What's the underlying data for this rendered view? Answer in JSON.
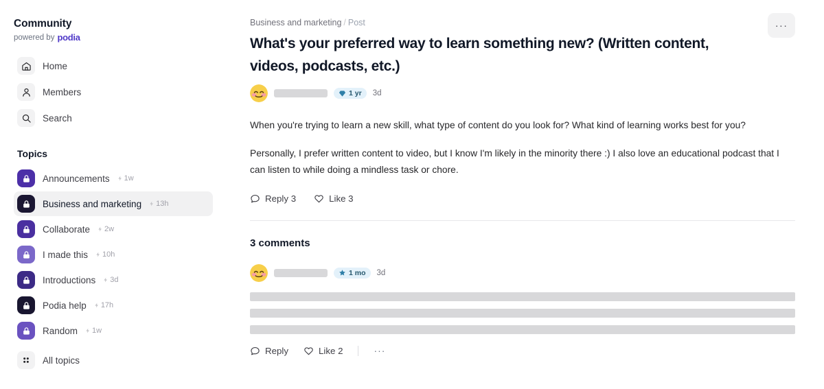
{
  "sidebar": {
    "brand": {
      "title": "Community",
      "powered_prefix": "powered by",
      "powered_brand": "podia",
      "brand_color": "#4f39c8"
    },
    "nav": [
      {
        "label": "Home",
        "icon": "home-icon"
      },
      {
        "label": "Members",
        "icon": "members-icon"
      },
      {
        "label": "Search",
        "icon": "search-icon"
      }
    ],
    "topics_heading": "Topics",
    "topics": [
      {
        "label": "Announcements",
        "time": "1w",
        "icon": "lock-icon",
        "color": "#4c2fa8",
        "active": false
      },
      {
        "label": "Business and marketing",
        "time": "13h",
        "icon": "lock-icon",
        "color": "#1b1733",
        "active": true
      },
      {
        "label": "Collaborate",
        "time": "2w",
        "icon": "lock-icon",
        "color": "#4a2fa0",
        "active": false
      },
      {
        "label": "I made this",
        "time": "10h",
        "icon": "lock-icon",
        "color": "#7b68c9",
        "active": false
      },
      {
        "label": "Introductions",
        "time": "3d",
        "icon": "lock-icon",
        "color": "#3c2a86",
        "active": false
      },
      {
        "label": "Podia help",
        "time": "17h",
        "icon": "lock-icon",
        "color": "#191630",
        "active": false
      },
      {
        "label": "Random",
        "time": "1w",
        "icon": "lock-icon",
        "color": "#6a52c0",
        "active": false
      }
    ],
    "all_topics": {
      "label": "All topics",
      "icon": "grid-icon"
    }
  },
  "main": {
    "breadcrumb": {
      "parent": "Business and marketing",
      "separator": "/",
      "current": "Post"
    },
    "post": {
      "title": "What's your preferred way to learn something new? (Written content, videos, podcasts, etc.)",
      "author": {
        "avatar": "blushing-smiley-emoji",
        "name_redacted": true
      },
      "badge": {
        "label": "1 yr",
        "icon": "gem-icon",
        "bg": "#e3f1fa",
        "fg": "#27586e"
      },
      "time": "3d",
      "paragraphs": [
        "When you're trying to learn a new skill, what type of content do you look for? What kind of learning works best for you?",
        "Personally, I prefer written content to video, but I know I'm likely in the minority there :) I also love an educational podcast that I can listen to while doing a mindless task or chore."
      ],
      "actions": {
        "reply": {
          "label": "Reply 3",
          "icon": "comment-icon"
        },
        "like": {
          "label": "Like 3",
          "icon": "heart-icon"
        }
      }
    },
    "comments_heading": "3 comments",
    "comments": [
      {
        "author": {
          "avatar": "blushing-smiley-emoji",
          "name_redacted": true
        },
        "badge": {
          "label": "1 mo",
          "icon": "star-icon",
          "bg": "#e3f1fa",
          "fg": "#27586e"
        },
        "time": "3d",
        "body_redacted_lines": 3,
        "actions": {
          "reply": {
            "label": "Reply",
            "icon": "comment-icon"
          },
          "like": {
            "label": "Like 2",
            "icon": "heart-icon"
          },
          "more": {
            "label": "···",
            "icon": "ellipsis-icon"
          }
        }
      }
    ],
    "more_button": {
      "label": "···",
      "icon": "ellipsis-icon"
    }
  }
}
